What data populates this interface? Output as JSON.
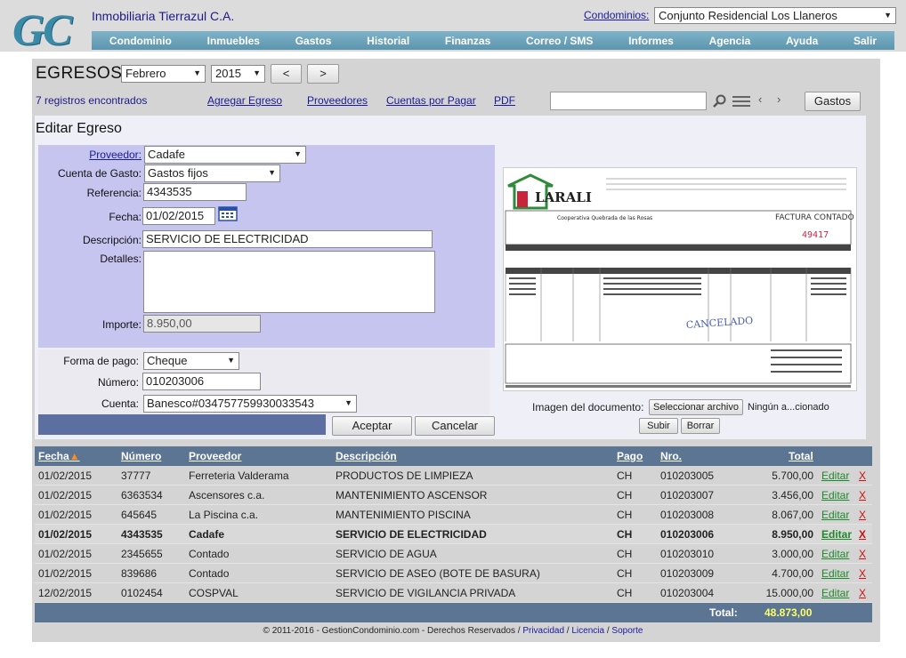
{
  "header": {
    "logo_text": "GC",
    "company": "Inmobiliaria Tierrazul C.A.",
    "condo_label": "Condominios:",
    "condo_selected": "Conjunto Residencial Los Llaneros",
    "menu": [
      "Condominio",
      "Inmuebles",
      "Gastos",
      "Historial",
      "Finanzas",
      "Correo / SMS",
      "Informes",
      "Agencia",
      "Ayuda",
      "Salir"
    ]
  },
  "toolbar": {
    "title": "EGRESOS",
    "month": "Febrero",
    "year": "2015",
    "prev": "<",
    "next": ">",
    "count_text": "7 registros encontrados",
    "links": [
      "Agregar Egreso",
      "Proveedores",
      "Cuentas por Pagar",
      "PDF"
    ],
    "search_value": "",
    "gastos_button": "Gastos"
  },
  "form": {
    "title": "Editar Egreso",
    "proveedor_label": "Proveedor:",
    "proveedor": "Cadafe",
    "cuenta_gasto_label": "Cuenta de Gasto:",
    "cuenta_gasto": "Gastos fijos",
    "referencia_label": "Referencia:",
    "referencia": "4343535",
    "fecha_label": "Fecha:",
    "fecha": "01/02/2015",
    "descripcion_label": "Descripción:",
    "descripcion": "SERVICIO DE ELECTRICIDAD",
    "detalles_label": "Detalles:",
    "detalles": "",
    "importe_label": "Importe:",
    "importe": "8.950,00",
    "forma_pago_label": "Forma de pago:",
    "forma_pago": "Cheque",
    "numero_label": "Número:",
    "numero": "010203006",
    "cuenta_label": "Cuenta:",
    "cuenta": "Banesco#034757759930033543",
    "accept": "Aceptar",
    "cancel": "Cancelar"
  },
  "document": {
    "label": "Imagen del documento:",
    "select_button": "Seleccionar archivo",
    "file_name": "Ningún a...cionado",
    "upload_button": "Subir",
    "delete_button": "Borrar",
    "invoice_company": "LARALI",
    "invoice_type": "FACTURA CONTADO",
    "invoice_number": "49417",
    "client_name": "Cooperativa Quebrada de las Rosas",
    "stamp": "CANCELADO"
  },
  "table": {
    "headers": [
      "Fecha",
      "Número",
      "Proveedor",
      "Descripción",
      "Pago",
      "Nro.",
      "Total"
    ],
    "sort_indicator": "▲",
    "edit_label": "Editar",
    "delete_label": "X",
    "rows": [
      [
        "01/02/2015",
        "37777",
        "Ferreteria Valderama",
        "PRODUCTOS DE LIMPIEZA",
        "CH",
        "010203005",
        "5.700,00"
      ],
      [
        "01/02/2015",
        "6363534",
        "Ascensores c.a.",
        "MANTENIMIENTO ASCENSOR",
        "CH",
        "010203007",
        "3.456,00"
      ],
      [
        "01/02/2015",
        "645645",
        "La Piscina c.a.",
        "MANTENIMIENTO PISCINA",
        "CH",
        "010203008",
        "8.067,00"
      ],
      [
        "01/02/2015",
        "4343535",
        "Cadafe",
        "SERVICIO DE ELECTRICIDAD",
        "CH",
        "010203006",
        "8.950,00"
      ],
      [
        "01/02/2015",
        "2345655",
        "Contado",
        "SERVICIO DE AGUA",
        "CH",
        "010203010",
        "3.000,00"
      ],
      [
        "01/02/2015",
        "839686",
        "Contado",
        "SERVICIO DE ASEO (BOTE DE BASURA)",
        "CH",
        "010203009",
        "4.700,00"
      ],
      [
        "12/02/2015",
        "0102454",
        "COSPVAL",
        "SERVICIO DE VIGILANCIA PRIVADA",
        "CH",
        "010203004",
        "15.000,00"
      ]
    ],
    "total_label": "Total:",
    "total_value": "48.873,00"
  },
  "footer": {
    "text": "© 2011-2016 - GestionCondominio.com - Derechos Reservados /",
    "links": [
      "Privacidad",
      "Licencia",
      "Soporte"
    ]
  },
  "colors": {
    "accent": "#5c7593",
    "menu": "#6ea6be",
    "form_bg": "#c5c5f0",
    "edit_link": "#1d8a2a",
    "delete_link": "#d01010",
    "total_value": "#ffff66"
  }
}
